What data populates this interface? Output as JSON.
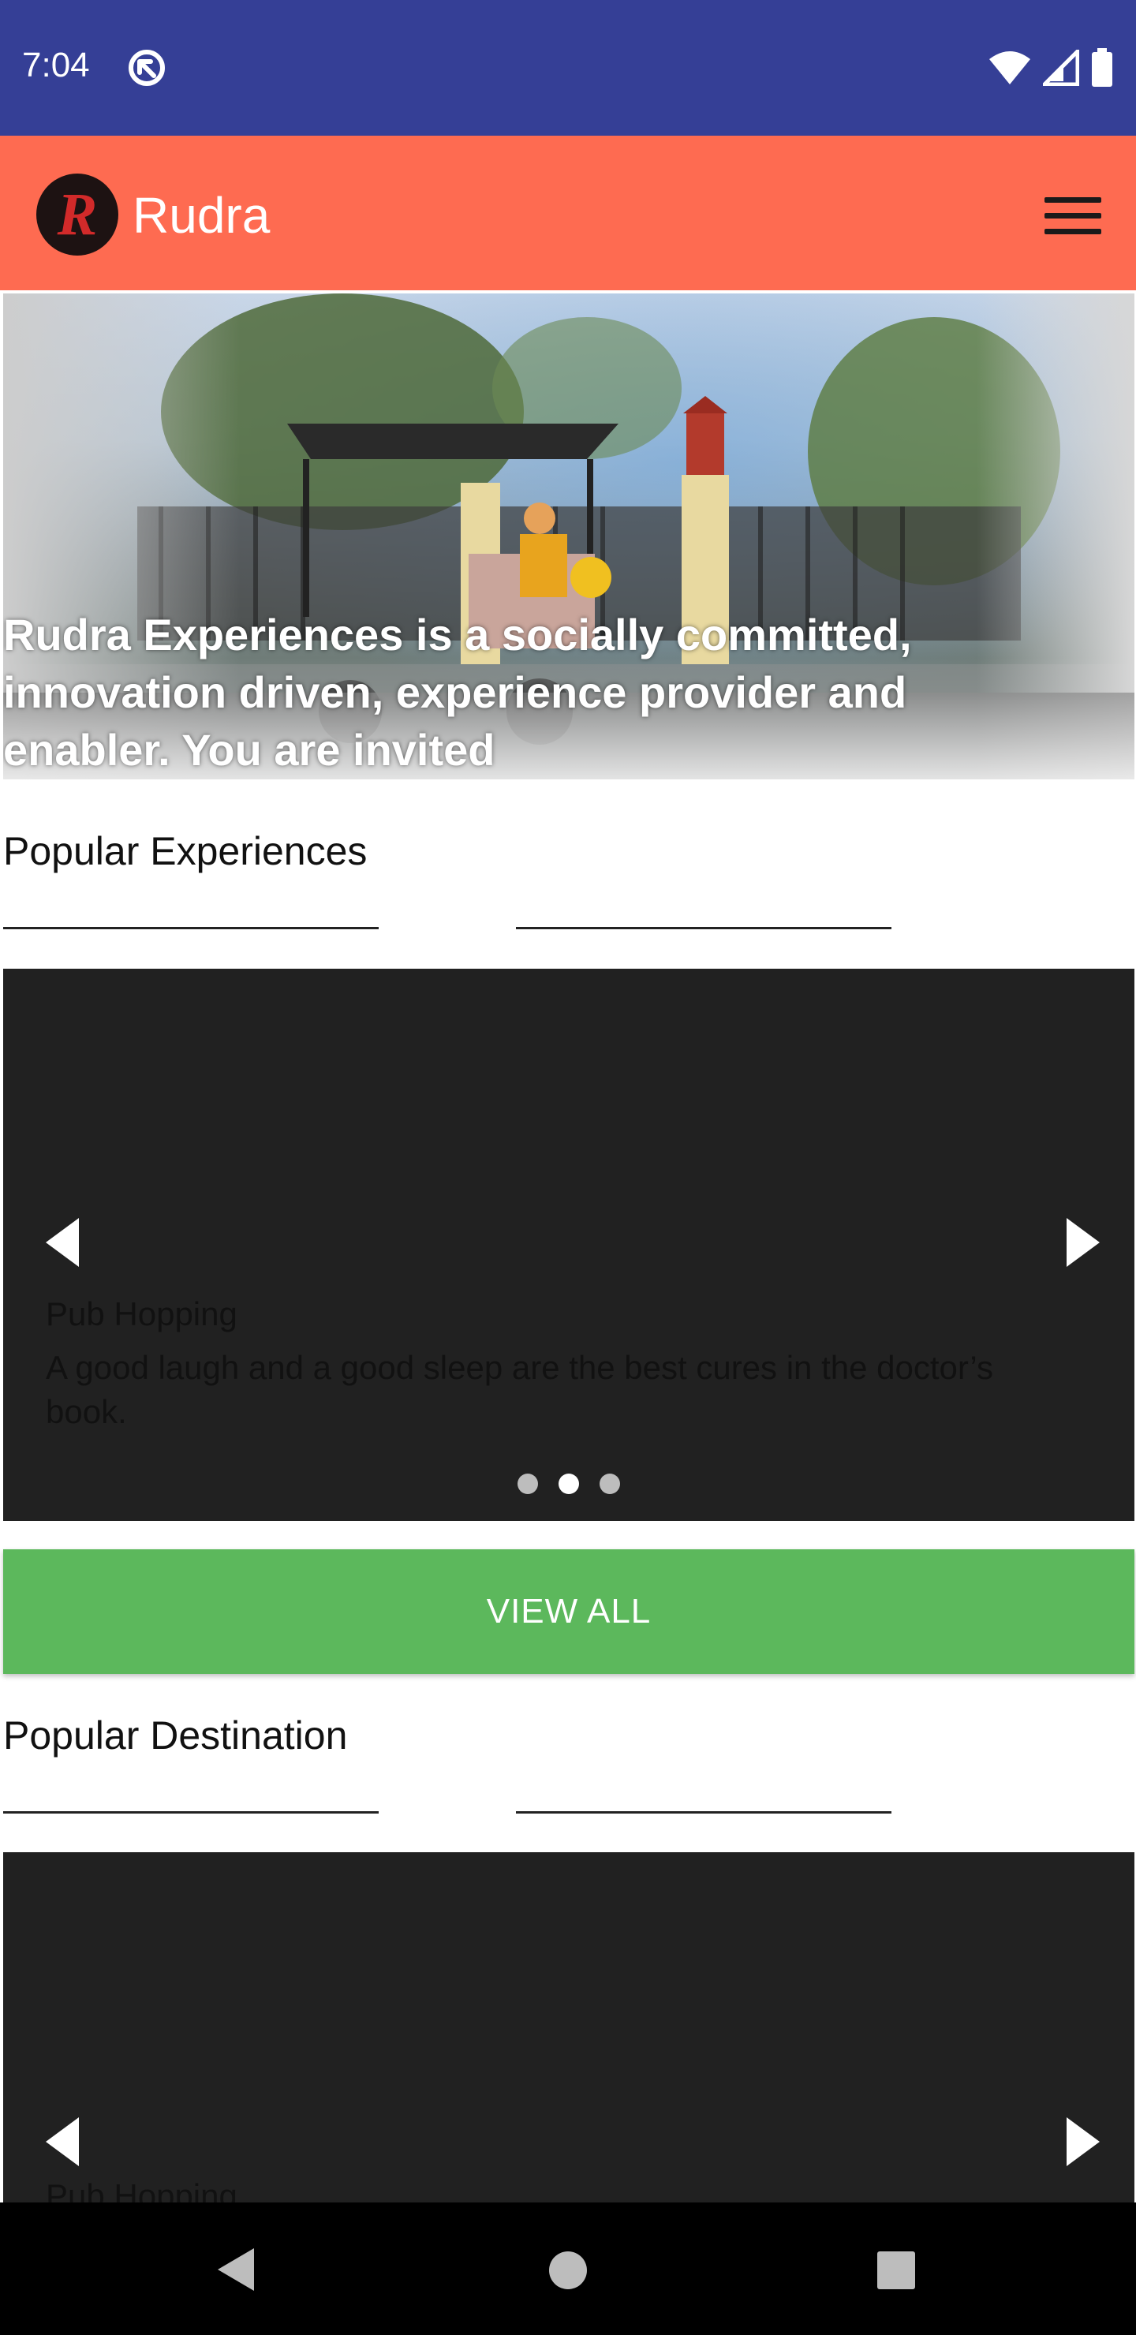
{
  "status_bar": {
    "time": "7:04",
    "icons": [
      "app-notification-icon",
      "wifi-icon",
      "cellular-signal-icon",
      "battery-icon"
    ],
    "background": "#353f96"
  },
  "app_bar": {
    "logo_letter": "R",
    "title": "Rudra",
    "background": "#fe6b51",
    "menu_icon": "hamburger-menu-icon"
  },
  "hero": {
    "caption": "Rudra Experiences is a socially committed, innovation driven, experience provider and enabler. You are invited"
  },
  "popular_experiences": {
    "title": "Popular Experiences",
    "slide": {
      "title": "Pub Hopping",
      "description": "A good laugh and a good sleep are the best cures in the doctor’s book."
    },
    "indicator_count": 3,
    "active_indicator": 2
  },
  "view_all": {
    "label": "VIEW ALL",
    "color": "#5cb85c"
  },
  "popular_destination": {
    "title": "Popular Destination",
    "slide": {
      "title": "Pub Hopping"
    }
  },
  "nav_bar": {
    "buttons": [
      "back-icon",
      "home-icon",
      "recents-icon"
    ]
  }
}
